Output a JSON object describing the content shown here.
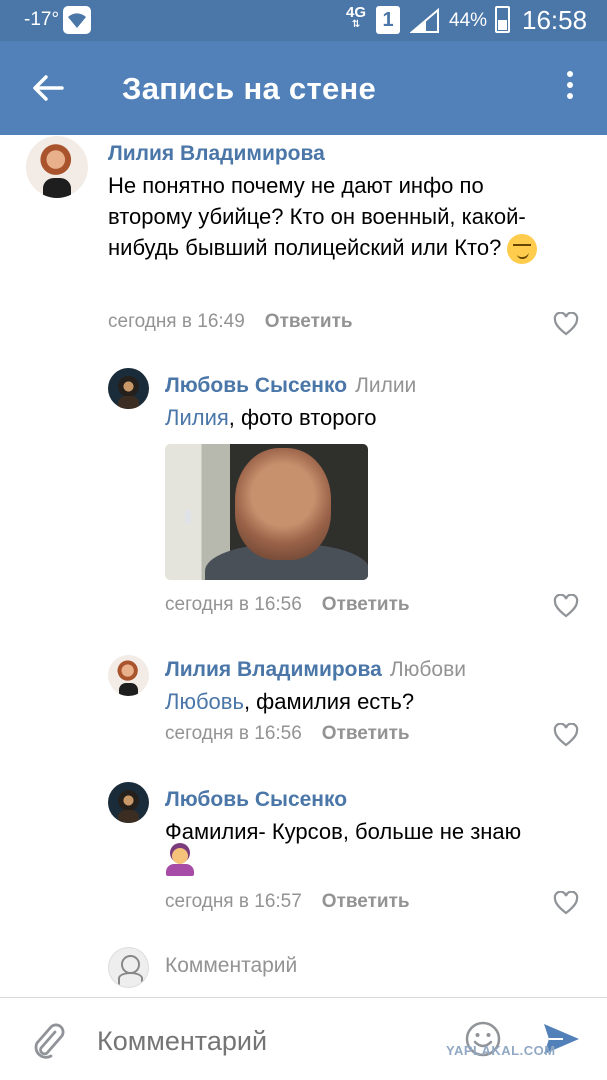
{
  "status_bar": {
    "temperature": "-17°",
    "network": "4G",
    "network_arrows": "⇅",
    "sim": "1",
    "battery": "44%",
    "time": "16:58"
  },
  "toolbar": {
    "title": "Запись на стене"
  },
  "comments": [
    {
      "author": "Лилия Владимирова",
      "text": "Не понятно почему не дают инфо по второму убийце? Кто он военный, какой-нибудь бывший полицейский или Кто?",
      "emoji": "smirking-face",
      "time": "сегодня в 16:49",
      "reply_label": "Ответить"
    },
    {
      "author": "Любовь Сысенко",
      "reply_to": "Лилии",
      "mention": "Лилия",
      "text": ", фото второго",
      "time": "сегодня в 16:56",
      "reply_label": "Ответить"
    },
    {
      "author": "Лилия Владимирова",
      "reply_to": "Любови",
      "mention": "Любовь",
      "text": ", фамилия есть?",
      "time": "сегодня в 16:56",
      "reply_label": "Ответить"
    },
    {
      "author": "Любовь Сысенко",
      "text": "Фамилия- Курсов, больше не знаю",
      "emoji": "person-shrugging",
      "time": "сегодня в 16:57",
      "reply_label": "Ответить"
    }
  ],
  "comment_prompt": "Комментарий",
  "input": {
    "placeholder": "Комментарий"
  },
  "watermark": "YAPLAKAL.COM",
  "colors": {
    "status_bar": "#4a76a8",
    "toolbar": "#5181b8",
    "link": "#4a76a8",
    "secondary_text": "#939393"
  }
}
